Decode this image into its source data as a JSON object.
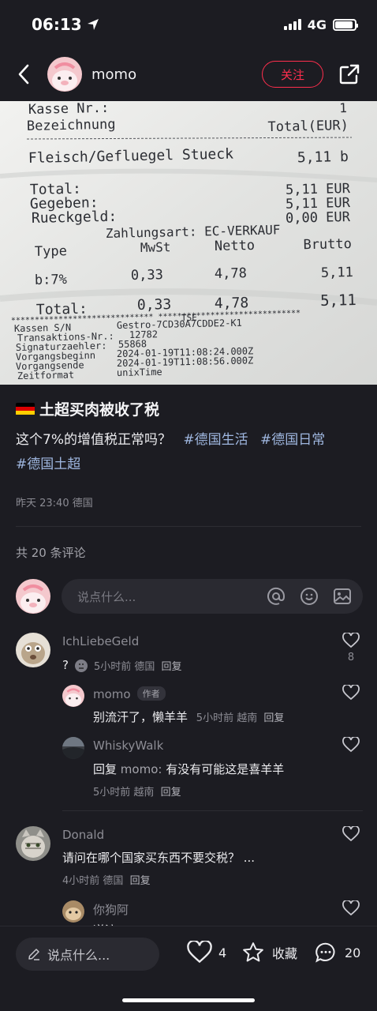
{
  "status_bar": {
    "time": "06:13",
    "network": "4G",
    "battery_level": 0.9
  },
  "nav": {
    "username": "momo",
    "follow_label": "关注"
  },
  "receipt": {
    "lines": [
      "Kasse Nr.:",
      "Bezeichnung",
      "Total(EUR)",
      "1",
      "Fleisch/Gefluegel Stueck",
      "5,11 b",
      "Total:",
      "Gegeben:",
      "Rueckgeld:",
      "5,11 EUR",
      "5,11 EUR",
      "0,00 EUR",
      "Zahlungsart: EC-VERKAUF",
      "Type",
      "MwSt",
      "Netto",
      "Brutto",
      "b:7%",
      "0,33",
      "4,78",
      "5,11",
      "Total:",
      "0,33",
      "4,78",
      "5,11",
      "TSE",
      "Kassen S/N",
      "Gestro-7CD30A7CDDE2-K1",
      "Transaktions-Nr.:",
      "12782",
      "Signaturzaehler:",
      "55868",
      "Vorgangsbeginn",
      "2024-01-19T11:08:24.000Z",
      "Vorgangsende",
      "2024-01-19T11:08:56.000Z",
      "Zeitformat",
      "unixTime"
    ]
  },
  "post": {
    "title": "土超买肉被收了税",
    "body": "这个7%的增值税正常吗？",
    "hashtags": [
      "#德国生活",
      "#德国日常",
      "#德国土超"
    ],
    "meta": "昨天 23:40 德国"
  },
  "comments_header": "共 20 条评论",
  "comment_input_placeholder": "说点什么...",
  "comments": [
    {
      "name": "IchLiebeGeld",
      "text": "?",
      "time": "5小时前",
      "location": "德国",
      "reply_label": "回复",
      "likes": "8"
    },
    {
      "name": "momo",
      "badge": "作者",
      "text": "别流汗了，懒羊羊",
      "time": "5小时前",
      "location": "越南",
      "reply_label": "回复"
    },
    {
      "name": "WhiskyWalk",
      "reply_prefix": "回复",
      "reply_target": "momo:",
      "text": "有没有可能这是喜羊羊",
      "time": "5小时前",
      "location": "越南",
      "reply_label": "回复"
    },
    {
      "name": "Donald",
      "text": "请问在哪个国家买东西不要交税？ ...",
      "time": "4小时前",
      "location": "德国",
      "reply_label": "回复"
    },
    {
      "name": "你狗阿",
      "text": "逆流"
    }
  ],
  "bottom_bar": {
    "input_placeholder": "说点什么...",
    "likes": "4",
    "collect_label": "收藏",
    "comments": "20"
  },
  "colors": {
    "accent": "#ff2e4d",
    "hashtag": "#9fb7e0",
    "background": "#1c1c22"
  }
}
